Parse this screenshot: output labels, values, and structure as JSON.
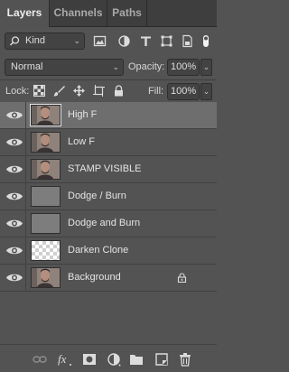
{
  "tabs": [
    "Layers",
    "Channels",
    "Paths"
  ],
  "filter": {
    "kind_label": "Kind",
    "icons": [
      "pixel-filter-icon",
      "adjustment-filter-icon",
      "type-filter-icon",
      "shape-filter-icon",
      "smart-object-filter-icon",
      "filter-toggle-icon"
    ]
  },
  "blend": {
    "mode": "Normal",
    "opacity_label": "Opacity:",
    "opacity_value": "100%"
  },
  "lock": {
    "label": "Lock:",
    "icons": [
      "lock-transparent-icon",
      "lock-pixels-icon",
      "lock-position-icon",
      "lock-artboard-icon",
      "lock-all-icon"
    ],
    "fill_label": "Fill:",
    "fill_value": "100%"
  },
  "layers": [
    {
      "name": "High F",
      "thumbnail": "portrait",
      "selected": true
    },
    {
      "name": "Low F",
      "thumbnail": "portrait",
      "selected": false
    },
    {
      "name": "STAMP VISIBLE",
      "thumbnail": "portrait",
      "selected": false
    },
    {
      "name": "Dodge / Burn",
      "thumbnail": "grey",
      "selected": false
    },
    {
      "name": "Dodge and Burn",
      "thumbnail": "grey",
      "selected": false
    },
    {
      "name": "Darken Clone",
      "thumbnail": "transparent",
      "selected": false
    },
    {
      "name": "Background",
      "thumbnail": "portrait",
      "selected": false,
      "locked": true
    }
  ],
  "footer_icons": [
    "link-layers-icon",
    "fx-icon",
    "add-mask-icon",
    "adjustment-layer-icon",
    "new-group-icon",
    "new-layer-icon",
    "delete-icon"
  ],
  "colors": {
    "panel": "#535353",
    "tab_bar": "#3e3e3e",
    "selected_row": "#6e6e6e"
  }
}
